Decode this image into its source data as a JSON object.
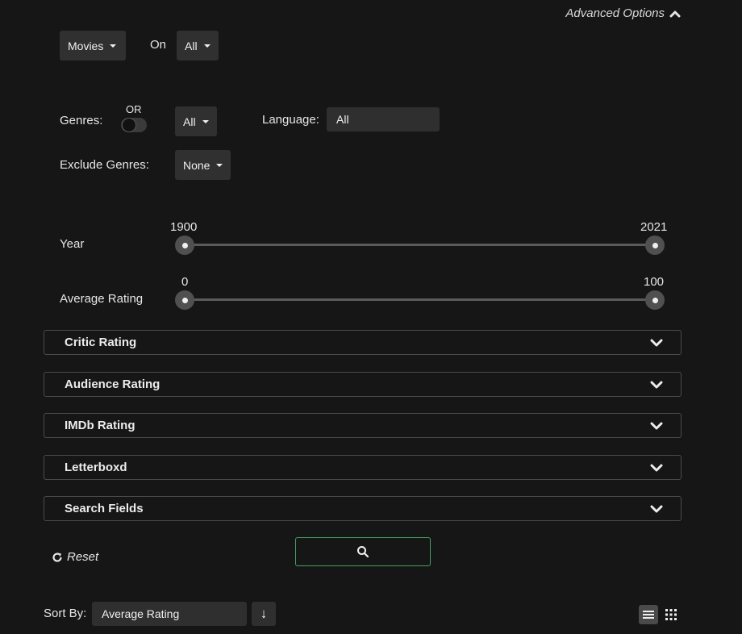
{
  "advanced": {
    "label": "Advanced Options"
  },
  "filters": {
    "media_type": "Movies",
    "on_label": "On",
    "on_value": "All",
    "genres_label": "Genres:",
    "genres_toggle_label": "OR",
    "genres_value": "All",
    "language_label": "Language:",
    "language_value": "All",
    "exclude_genres_label": "Exclude Genres:",
    "exclude_genres_value": "None"
  },
  "sliders": {
    "year": {
      "label": "Year",
      "min": "1900",
      "max": "2021"
    },
    "avg_rating": {
      "label": "Average Rating",
      "min": "0",
      "max": "100"
    }
  },
  "accordions": [
    {
      "title": "Critic Rating"
    },
    {
      "title": "Audience Rating"
    },
    {
      "title": "IMDb Rating"
    },
    {
      "title": "Letterboxd"
    },
    {
      "title": "Search Fields"
    }
  ],
  "actions": {
    "reset_label": "Reset"
  },
  "sort": {
    "label": "Sort By:",
    "value": "Average Rating",
    "direction_icon": "↓"
  },
  "icons": {
    "chevron": "chevron-down-icon",
    "search": "search-icon",
    "reset": "refresh-icon",
    "list_view": "list-view-icon",
    "grid_view": "grid-view-icon"
  },
  "colors": {
    "background": "#161616",
    "search_border": "#3fa45f"
  }
}
